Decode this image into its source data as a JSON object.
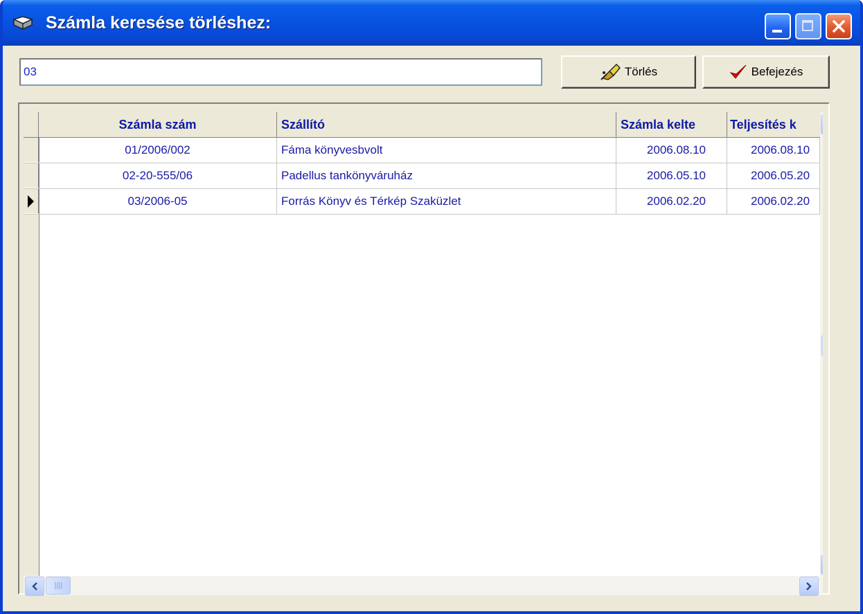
{
  "window": {
    "title": "Számla keresése törléshez:",
    "buttons": {
      "minimize": "minimize",
      "maximize": "maximize",
      "close": "close"
    }
  },
  "search": {
    "value": "03",
    "placeholder": ""
  },
  "toolbar": {
    "delete_label": "Törlés",
    "finish_label": "Befejezés"
  },
  "grid": {
    "columns": [
      "Számla szám",
      "Szállító",
      "Számla kelte",
      "Teljesítés k"
    ],
    "rows": [
      {
        "number": "01/2006/002",
        "supplier": "Fáma könyvesbvolt",
        "date": "2006.08.10",
        "completion": "2006.08.10"
      },
      {
        "number": "02-20-555/06",
        "supplier": "Padellus tankönyváruház",
        "date": "2006.05.10",
        "completion": "2006.05.20"
      },
      {
        "number": "03/2006-05",
        "supplier": "Forrás Könyv és Térkép Szaküzlet",
        "date": "2006.02.20",
        "completion": "2006.02.20"
      }
    ],
    "selected_row": 2
  },
  "icons": {
    "title": "book-icon",
    "delete": "eraser-icon",
    "finish": "checkmark-icon",
    "row_pointer": "row-pointer-icon"
  },
  "colors": {
    "titlebar": "#0852e0",
    "text_blue": "#1a1aa8",
    "close_button": "#e05a2c",
    "checkmark": "#d21010"
  }
}
